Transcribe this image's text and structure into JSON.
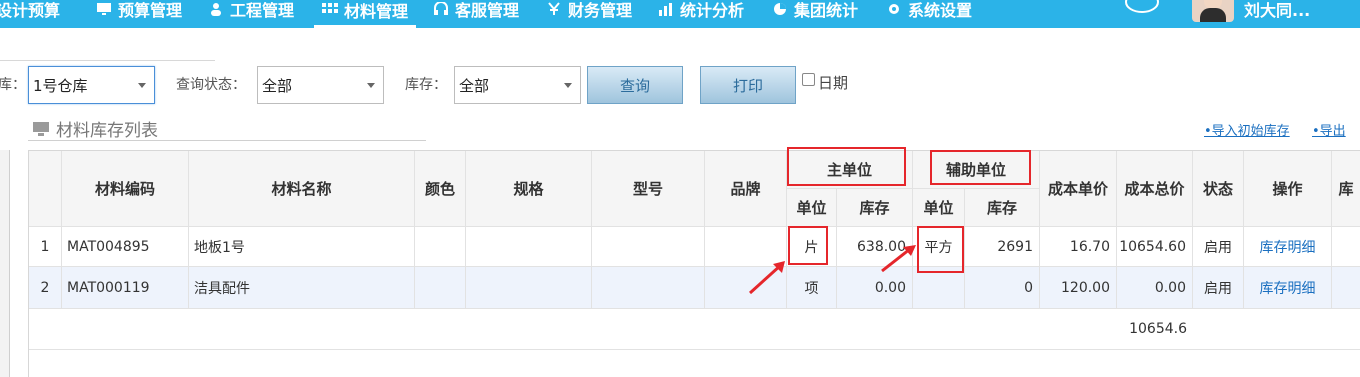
{
  "nav": {
    "items": [
      {
        "label": "设计预算",
        "icon": "calculator-icon"
      },
      {
        "label": "预算管理",
        "icon": "monitor-icon"
      },
      {
        "label": "工程管理",
        "icon": "users-icon"
      },
      {
        "label": "材料管理",
        "icon": "grid-icon",
        "active": true
      },
      {
        "label": "客服管理",
        "icon": "headset-icon"
      },
      {
        "label": "财务管理",
        "icon": "yen-icon"
      },
      {
        "label": "统计分析",
        "icon": "bar-chart-icon"
      },
      {
        "label": "集团统计",
        "icon": "pie-chart-icon"
      },
      {
        "label": "系统设置",
        "icon": "gear-icon"
      }
    ],
    "user_name": "刘大同..."
  },
  "filters": {
    "warehouse_label": "库：",
    "warehouse_value": "1号仓库",
    "status_label": "查询状态：",
    "status_value": "全部",
    "stock_label": "库存：",
    "stock_value": "全部",
    "query_button": "查询",
    "print_button": "打印",
    "date_checkbox": "日期"
  },
  "section": {
    "title": "材料库存列表",
    "import_link": "•导入初始库存",
    "export_link": "•导出"
  },
  "table": {
    "headers": {
      "code": "材料编码",
      "name": "材料名称",
      "color": "颜色",
      "spec": "规格",
      "model": "型号",
      "brand": "品牌",
      "main_unit_group": "主单位",
      "aux_unit_group": "辅助单位",
      "unit": "单位",
      "stock": "库存",
      "aux_unit": "单位",
      "aux_stock": "库存",
      "cost_unit": "成本单价",
      "cost_total": "成本总价",
      "status": "状态",
      "action": "操作",
      "extra": "库"
    },
    "rows": [
      {
        "idx": "1",
        "code": "MAT004895",
        "name": "地板1号",
        "color": "",
        "spec": "",
        "model": "",
        "brand": "",
        "unit": "片",
        "stock": "638.00",
        "aux_unit": "平方",
        "aux_stock": "2691",
        "cost_unit": "16.70",
        "cost_total": "10654.60",
        "status": "启用",
        "action": "库存明细"
      },
      {
        "idx": "2",
        "code": "MAT000119",
        "name": "洁具配件",
        "color": "",
        "spec": "",
        "model": "",
        "brand": "",
        "unit": "项",
        "stock": "0.00",
        "aux_unit": "",
        "aux_stock": "0",
        "cost_unit": "120.00",
        "cost_total": "0.00",
        "status": "启用",
        "action": "库存明细"
      }
    ],
    "total": "10654.6"
  },
  "colors": {
    "nav_bg": "#2bb3e8",
    "annotation_red": "#e5262b",
    "link_blue": "#1a6fc0",
    "alt_row": "#eef3fc"
  }
}
